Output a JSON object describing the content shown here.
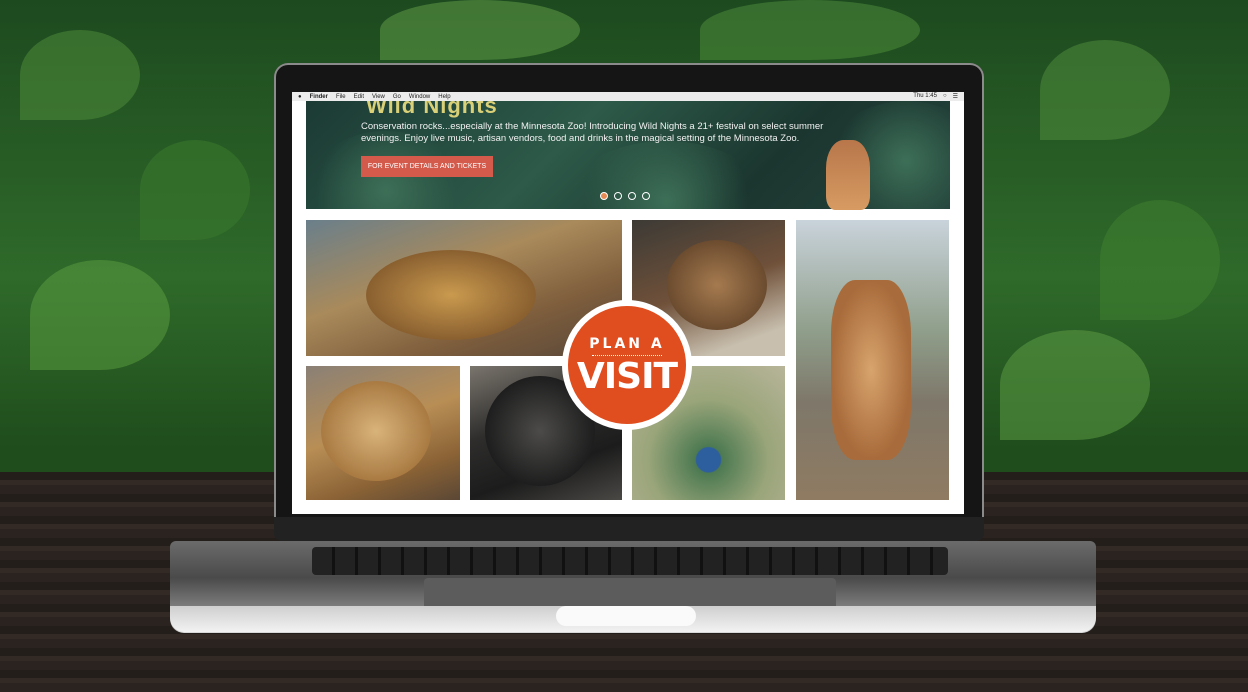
{
  "menubar": {
    "apple": "",
    "items": [
      "Finder",
      "File",
      "Edit",
      "View",
      "Go",
      "Window",
      "Help"
    ],
    "clock": "Thu 1:45"
  },
  "hero": {
    "title": "Wild Nights",
    "text": "Conservation rocks...especially at the Minnesota Zoo! Introducing Wild Nights a 21+ festival on select summer evenings. Enjoy live music, artisan vendors, food and drinks in the magical setting of the Minnesota Zoo.",
    "button": "FOR EVENT DETAILS AND TICKETS",
    "slides": 4,
    "active_slide": 1
  },
  "badge": {
    "line1": "PLAN A",
    "line2": "VISIT"
  },
  "colors": {
    "accent": "#e04d1f",
    "button": "#d45a4c"
  }
}
